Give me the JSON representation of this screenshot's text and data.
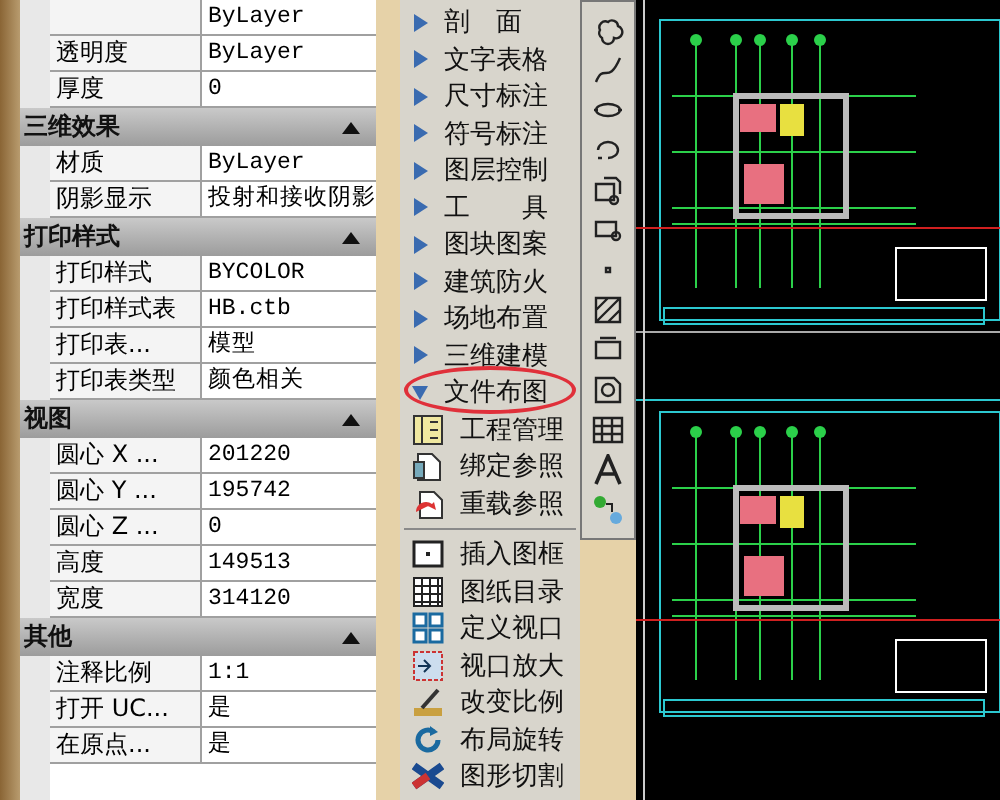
{
  "properties": {
    "sections": [
      {
        "rows": [
          {
            "label": null,
            "value": "ByLayer"
          },
          {
            "label": "透明度",
            "value": "ByLayer"
          },
          {
            "label": "厚度",
            "value": "0"
          }
        ]
      },
      {
        "title": "三维效果",
        "expanded": true,
        "rows": [
          {
            "label": "材质",
            "value": "ByLayer"
          },
          {
            "label": "阴影显示",
            "value": "投射和接收阴影"
          }
        ]
      },
      {
        "title": "打印样式",
        "expanded": true,
        "rows": [
          {
            "label": "打印样式",
            "value": "BYCOLOR"
          },
          {
            "label": "打印样式表",
            "value": "HB.ctb"
          },
          {
            "label": "打印表...",
            "value": "模型"
          },
          {
            "label": "打印表类型",
            "value": "颜色相关"
          }
        ]
      },
      {
        "title": "视图",
        "expanded": true,
        "rows": [
          {
            "label": "圆心 X ...",
            "value": "201220"
          },
          {
            "label": "圆心 Y ...",
            "value": "195742"
          },
          {
            "label": "圆心 Z ...",
            "value": "0"
          },
          {
            "label": "高度",
            "value": "149513"
          },
          {
            "label": "宽度",
            "value": "314120"
          }
        ]
      },
      {
        "title": "其他",
        "expanded": true,
        "rows": [
          {
            "label": "注释比例",
            "value": "1:1"
          },
          {
            "label": "打开 UC...",
            "value": "是"
          },
          {
            "label": "在原点...",
            "value": "是"
          }
        ]
      }
    ]
  },
  "menu": {
    "categories": [
      {
        "label": "剖　面",
        "expanded": false,
        "circled": false
      },
      {
        "label": "文字表格",
        "expanded": false,
        "circled": false
      },
      {
        "label": "尺寸标注",
        "expanded": false,
        "circled": false
      },
      {
        "label": "符号标注",
        "expanded": false,
        "circled": false
      },
      {
        "label": "图层控制",
        "expanded": false,
        "circled": false
      },
      {
        "label": "工　　具",
        "expanded": false,
        "circled": false
      },
      {
        "label": "图块图案",
        "expanded": false,
        "circled": false
      },
      {
        "label": "建筑防火",
        "expanded": false,
        "circled": false
      },
      {
        "label": "场地布置",
        "expanded": false,
        "circled": false
      },
      {
        "label": "三维建模",
        "expanded": false,
        "circled": false
      },
      {
        "label": "文件布图",
        "expanded": true,
        "circled": true
      }
    ],
    "commands": [
      [
        "工程管理",
        "绑定参照",
        "重载参照"
      ],
      [
        "插入图框",
        "图纸目录",
        "定义视口",
        "视口放大",
        "改变比例",
        "布局旋转",
        "图形切割"
      ]
    ]
  }
}
